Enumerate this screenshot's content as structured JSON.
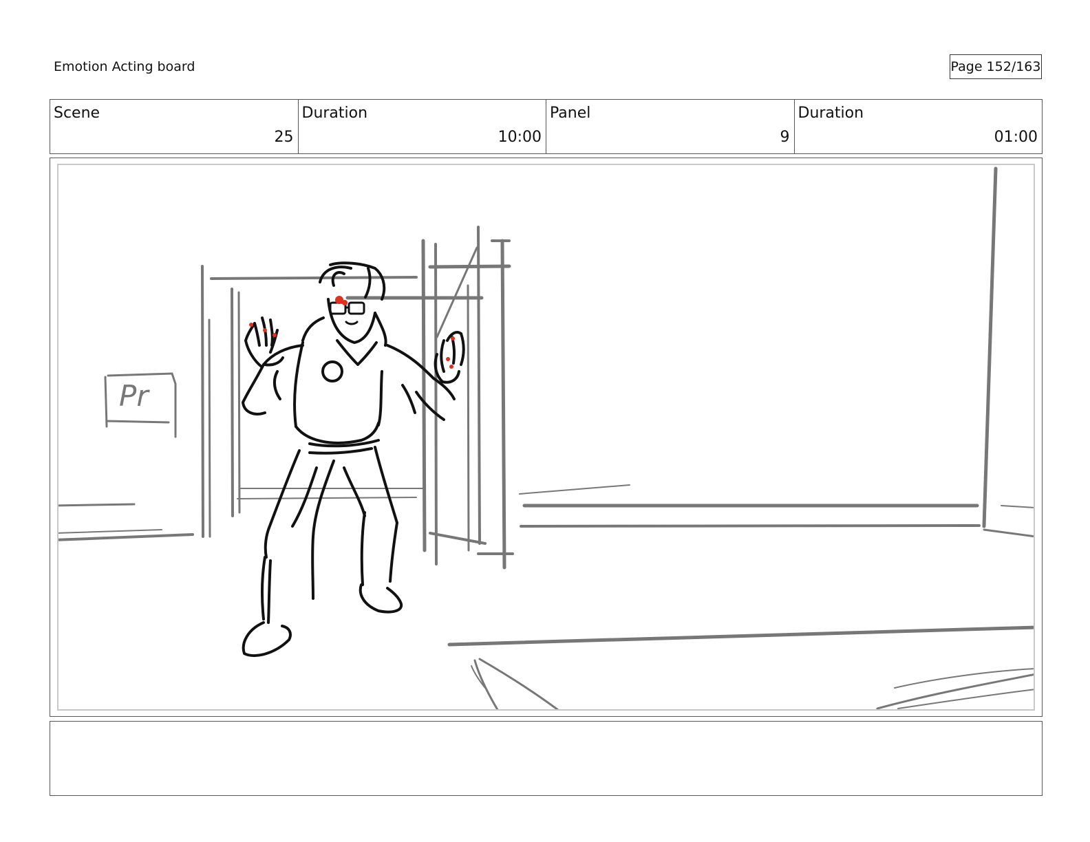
{
  "header": {
    "title": "Emotion Acting board",
    "page": "Page 152/163"
  },
  "info": {
    "scene_label": "Scene",
    "scene_value": "25",
    "scene_duration_label": "Duration",
    "scene_duration_value": "10:00",
    "panel_label": "Panel",
    "panel_value": "9",
    "panel_duration_label": "Duration",
    "panel_duration_value": "01:00"
  },
  "panel": {
    "sign_text": "Pr",
    "line_color": "#777777",
    "ink_color": "#111111",
    "accent_color": "#e0301e"
  },
  "notes": {
    "text": ""
  }
}
